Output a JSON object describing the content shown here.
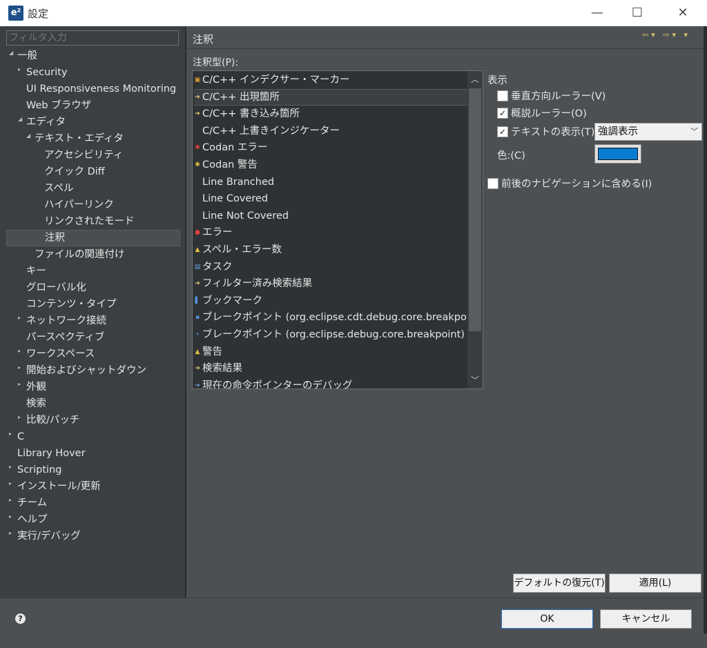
{
  "window": {
    "title": "設定",
    "app_icon": "e²",
    "minimize": "—",
    "maximize": "☐",
    "close": "✕"
  },
  "filter": {
    "placeholder": "フィルタ入力"
  },
  "tree": [
    {
      "label": "一般",
      "expanded": true
    },
    {
      "label": "Security",
      "collapsed": true
    },
    {
      "label": "UI Responsiveness Monitoring"
    },
    {
      "label": "Web ブラウザ"
    },
    {
      "label": "エディタ",
      "expanded": true
    },
    {
      "label": "テキスト・エディタ",
      "expanded": true
    },
    {
      "label": "アクセシビリティ"
    },
    {
      "label": "クイック Diff"
    },
    {
      "label": "スペル"
    },
    {
      "label": "ハイパーリンク"
    },
    {
      "label": "リンクされたモード"
    },
    {
      "label": "注釈",
      "selected": true
    },
    {
      "label": "ファイルの関連付け"
    },
    {
      "label": "キー"
    },
    {
      "label": "グローバル化"
    },
    {
      "label": "コンテンツ・タイプ"
    },
    {
      "label": "ネットワーク接続",
      "collapsed": true
    },
    {
      "label": "パースペクティブ"
    },
    {
      "label": "ワークスペース",
      "collapsed": true
    },
    {
      "label": "開始およびシャットダウン",
      "collapsed": true
    },
    {
      "label": "外観",
      "collapsed": true
    },
    {
      "label": "検索"
    },
    {
      "label": "比較/パッチ",
      "collapsed": true
    },
    {
      "label": "C",
      "collapsed": true
    },
    {
      "label": "Library Hover"
    },
    {
      "label": "Scripting",
      "collapsed": true
    },
    {
      "label": "インストール/更新",
      "collapsed": true
    },
    {
      "label": "チーム",
      "collapsed": true
    },
    {
      "label": "ヘルプ",
      "collapsed": true
    },
    {
      "label": "実行/デバッグ",
      "collapsed": true
    }
  ],
  "page": {
    "title": "注釈",
    "nav_arrows": "⇦▾ ⇨▾ ▾"
  },
  "annotation_list": {
    "label": "注釈型(P):",
    "items": [
      {
        "label": "C/C++ インデクサー・マーカー",
        "icon": "marker-icon",
        "color": "#e0a030",
        "glyph": "▣"
      },
      {
        "label": "C/C++ 出現箇所",
        "icon": "occurrence-icon",
        "color": "#e8d070",
        "glyph": "➔",
        "selected": true
      },
      {
        "label": "C/C++ 書き込み箇所",
        "icon": "write-occurrence-icon",
        "color": "#e8d070",
        "glyph": "➔"
      },
      {
        "label": "C/C++ 上書きインジケーター",
        "icon": "",
        "color": "",
        "glyph": ""
      },
      {
        "label": "Codan エラー",
        "icon": "error-icon",
        "color": "#e04040",
        "glyph": "✱"
      },
      {
        "label": "Codan 警告",
        "icon": "warning-icon",
        "color": "#e0c040",
        "glyph": "✱"
      },
      {
        "label": "Line Branched",
        "icon": "",
        "color": "",
        "glyph": ""
      },
      {
        "label": "Line Covered",
        "icon": "",
        "color": "",
        "glyph": ""
      },
      {
        "label": "Line Not Covered",
        "icon": "",
        "color": "",
        "glyph": ""
      },
      {
        "label": "エラー",
        "icon": "error-icon",
        "color": "#e04040",
        "glyph": "●"
      },
      {
        "label": "スペル・エラー数",
        "icon": "warning-triangle-icon",
        "color": "#e0c040",
        "glyph": "▲"
      },
      {
        "label": "タスク",
        "icon": "task-icon",
        "color": "#6aa0e0",
        "glyph": "▤"
      },
      {
        "label": "フィルター済み検索結果",
        "icon": "search-result-icon",
        "color": "#e8d070",
        "glyph": "➔"
      },
      {
        "label": "ブックマーク",
        "icon": "bookmark-icon",
        "color": "#5090e0",
        "glyph": "▌"
      },
      {
        "label": "ブレークポイント (org.eclipse.cdt.debug.core.breakpoint)",
        "icon": "breakpoint-icon",
        "color": "#5090e0",
        "glyph": "▪"
      },
      {
        "label": "ブレークポイント (org.eclipse.debug.core.breakpoint)",
        "icon": "breakpoint-icon",
        "color": "#5090e0",
        "glyph": "•"
      },
      {
        "label": "警告",
        "icon": "warning-triangle-icon",
        "color": "#e0c040",
        "glyph": "▲"
      },
      {
        "label": "検索結果",
        "icon": "search-result-icon",
        "color": "#e8d070",
        "glyph": "➔"
      },
      {
        "label": "現在の命令ポインターのデバッグ",
        "icon": "instruction-pointer-icon",
        "color": "#6aa0e0",
        "glyph": "➔"
      }
    ]
  },
  "display": {
    "label": "表示",
    "vertical_ruler": {
      "label": "垂直方向ルーラー(V)",
      "checked": false
    },
    "overview_ruler": {
      "label": "概説ルーラー(O)",
      "checked": true
    },
    "text_display": {
      "label": "テキストの表示(T)",
      "checked": true,
      "selected_option": "強調表示"
    },
    "color_label": "色:(C)",
    "color_value": "#0a7ccf",
    "navigation": {
      "label": "前後のナビゲーションに含める(I)",
      "checked": false
    }
  },
  "buttons": {
    "restore_defaults": "デフォルトの復元(T)",
    "apply": "適用(L)",
    "ok": "OK",
    "cancel": "キャンセル",
    "help": "?"
  }
}
